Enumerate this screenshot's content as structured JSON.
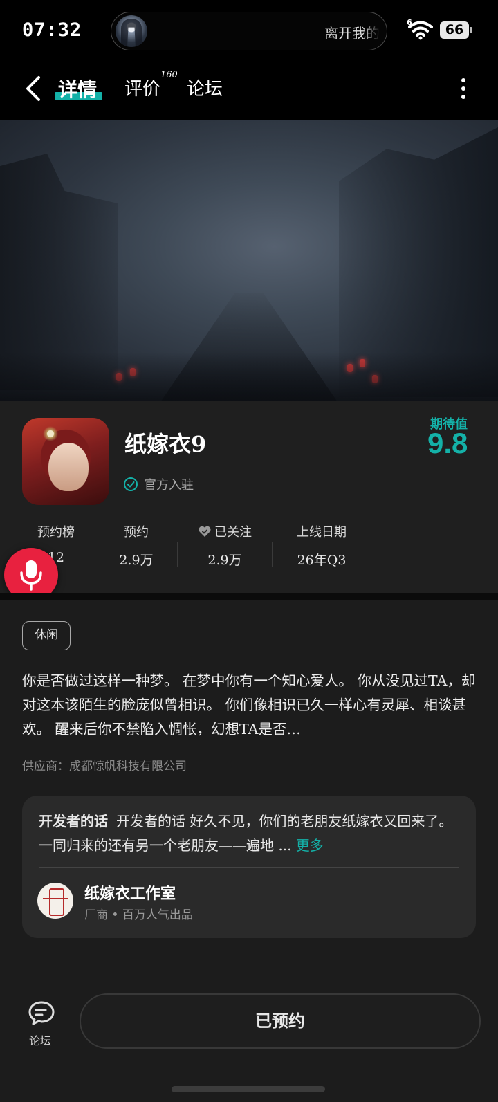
{
  "status_bar": {
    "time": "07:32",
    "media_text": "离开我的",
    "battery": "66"
  },
  "nav": {
    "tabs": [
      {
        "label": "详情",
        "active": true
      },
      {
        "label": "评价",
        "count": "160"
      },
      {
        "label": "论坛"
      }
    ]
  },
  "game": {
    "title": "纸嫁衣9",
    "verified_label": "官方入驻",
    "expectation_label": "期待值",
    "expectation_score": "9.8"
  },
  "stats": [
    {
      "label": "预约榜",
      "value": "12"
    },
    {
      "label": "预约",
      "value": "2.9万"
    },
    {
      "label": "已关注",
      "value": "2.9万"
    },
    {
      "label": "上线日期",
      "value": "26年Q3"
    }
  ],
  "tag": "休闲",
  "description": "你是否做过这样一种梦。 在梦中你有一个知心爱人。 你从没见过TA，却对这本该陌生的脸庞似曾相识。 你们像相识已久一样心有灵犀、相谈甚欢。 醒来后你不禁陷入惆怅，幻想TA是否…",
  "supplier": "供应商：成都惊帆科技有限公司",
  "developer": {
    "heading": "开发者的话",
    "text": "开发者的话 好久不见，你们的老朋友纸嫁衣又回来了。 一同归来的还有另一个老朋友——遍地 ...",
    "more_label": "更多",
    "studio_name": "纸嫁衣工作室",
    "studio_sub": "厂商 • 百万人气出品"
  },
  "bottom": {
    "forum_label": "论坛",
    "reserve_label": "已预约"
  },
  "colors": {
    "accent": "#14b1a8",
    "voice": "#e8213f"
  }
}
